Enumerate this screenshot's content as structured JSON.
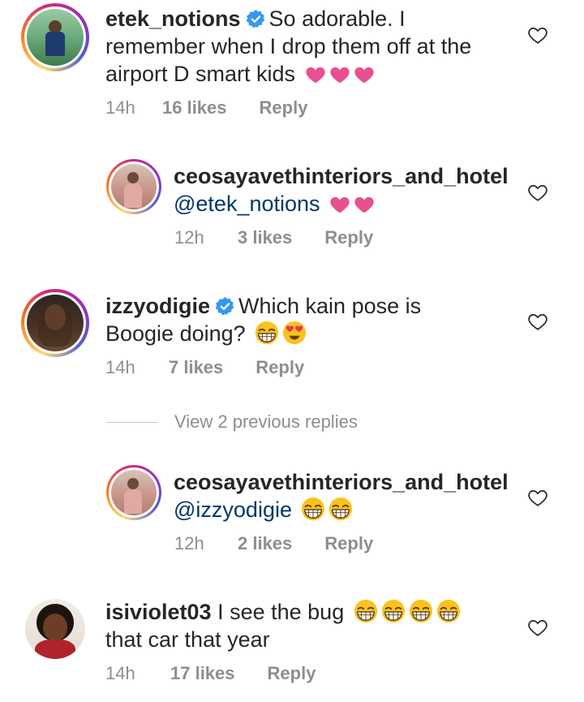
{
  "comments": [
    {
      "username": "etek_notions",
      "verified": true,
      "text_line1": "So adorable. I",
      "text_line2": "remember when I drop them off at the",
      "text_line3": "airport D smart kids",
      "emojis": [
        "heart",
        "heart",
        "heart"
      ],
      "time": "14h",
      "likes": "16 likes",
      "reply": "Reply"
    },
    {
      "username": "ceosayavethinteriors_and_hotel",
      "mention": "@etek_notions",
      "emojis": [
        "heart",
        "heart"
      ],
      "time": "12h",
      "likes": "3 likes",
      "reply": "Reply"
    },
    {
      "username": "izzyodigie",
      "verified": true,
      "text_line1": "Which kain pose is",
      "text_line2": "Boogie doing?",
      "emojis": [
        "grin",
        "heart-eyes"
      ],
      "time": "14h",
      "likes": "7 likes",
      "reply": "Reply"
    },
    {
      "username": "ceosayavethinteriors_and_hotel",
      "mention": "@izzyodigie",
      "emojis": [
        "grin",
        "grin"
      ],
      "time": "12h",
      "likes": "2 likes",
      "reply": "Reply"
    },
    {
      "username": "isiviolet03",
      "text_line1": "I see the bug",
      "text_line2": "that car that year",
      "emojis": [
        "grin",
        "grin",
        "grin",
        "grin"
      ],
      "time": "14h",
      "likes": "17 likes",
      "reply": "Reply"
    }
  ],
  "view_replies": "View 2 previous replies",
  "colors": {
    "text": "#262626",
    "meta": "#8e8e8e",
    "mention": "#00376b",
    "heart_emoji": "#e8508f",
    "verified": "#3897f0"
  }
}
